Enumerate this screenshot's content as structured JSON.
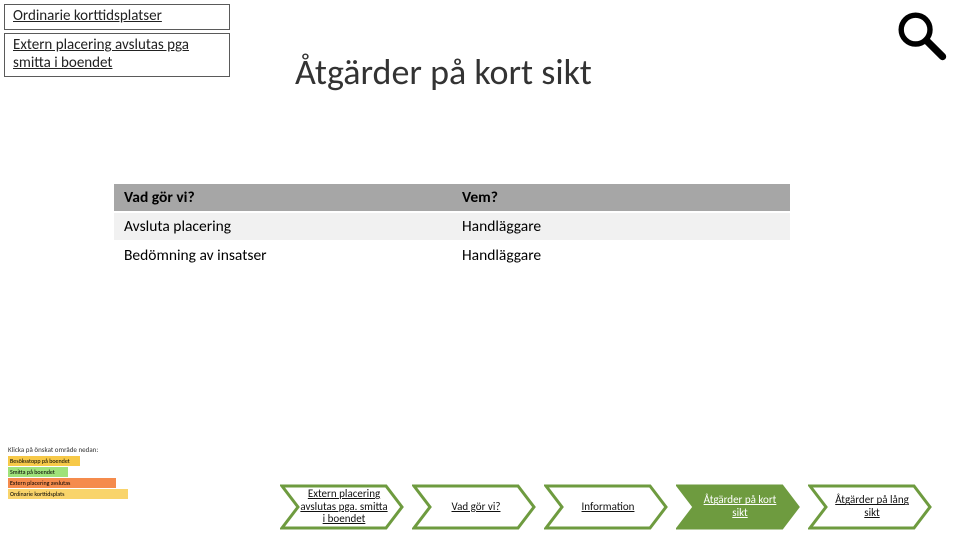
{
  "breadcrumbs": [
    "Ordinarie korttidsplatser",
    "Extern placering avslutas pga smitta i boendet"
  ],
  "title": "Åtgärder på kort sikt",
  "table": {
    "headers": [
      "Vad gör vi?",
      "Vem?"
    ],
    "rows": [
      [
        "Avsluta placering",
        "Handläggare"
      ],
      [
        "Bedömning av insatser",
        "Handläggare"
      ]
    ]
  },
  "thumb": {
    "caption": "Klicka på önskat område nedan:",
    "bars": [
      "Besöksstopp på boendet",
      "Smitta på boendet",
      "Extern placering avslutas",
      "Ordinarie korttidsplats"
    ]
  },
  "chevrons": [
    "Extern placering avslutas pga. smitta i boendet",
    "Vad gör vi?",
    "Information",
    "Åtgärder på kort sikt",
    "Åtgärder på lång sikt"
  ],
  "icons": {
    "magnifier": "search-icon"
  }
}
